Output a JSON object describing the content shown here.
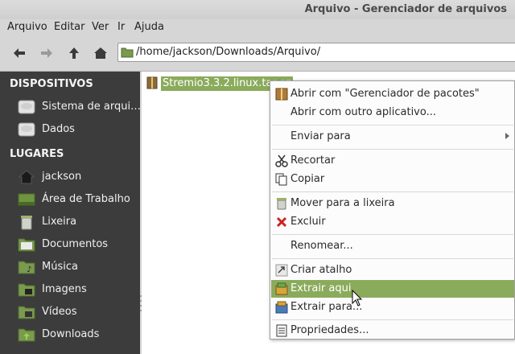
{
  "window": {
    "title": "Arquivo - Gerenciador de arquivos"
  },
  "menubar": [
    "Arquivo",
    "Editar",
    "Ver",
    "Ir",
    "Ajuda"
  ],
  "toolbar": {
    "back_icon": "back-arrow-icon",
    "forward_icon": "forward-arrow-icon",
    "up_icon": "up-arrow-icon",
    "home_icon": "home-icon",
    "path": "/home/jackson/Downloads/Arquivo/"
  },
  "sidebar": {
    "devices_header": "DISPOSITIVOS",
    "devices": [
      {
        "label": "Sistema de arqui…",
        "icon": "drive-icon"
      },
      {
        "label": "Dados",
        "icon": "drive-icon"
      }
    ],
    "places_header": "LUGARES",
    "places": [
      {
        "label": "jackson",
        "icon": "home-icon"
      },
      {
        "label": "Área de Trabalho",
        "icon": "desktop-icon"
      },
      {
        "label": "Lixeira",
        "icon": "trash-icon"
      },
      {
        "label": "Documentos",
        "icon": "folder-icon"
      },
      {
        "label": "Música",
        "icon": "music-folder-icon"
      },
      {
        "label": "Imagens",
        "icon": "pictures-folder-icon"
      },
      {
        "label": "Vídeos",
        "icon": "videos-folder-icon"
      },
      {
        "label": "Downloads",
        "icon": "downloads-folder-icon"
      }
    ]
  },
  "content": {
    "file": {
      "name": "Stremio3.3.2.linux.tar.gz",
      "icon": "archive-icon"
    }
  },
  "context_menu": {
    "items": [
      {
        "label": "Abrir com \"Gerenciador de pacotes\"",
        "icon": "package-icon"
      },
      {
        "label": "Abrir com outro aplicativo...",
        "icon": ""
      },
      {
        "label": "Enviar para",
        "icon": ""
      },
      {
        "label": "Recortar",
        "icon": "scissors-icon"
      },
      {
        "label": "Copiar",
        "icon": "copy-icon"
      },
      {
        "label": "Mover para a lixeira",
        "icon": "trash-icon"
      },
      {
        "label": "Excluir",
        "icon": "delete-icon"
      },
      {
        "label": "Renomear...",
        "icon": ""
      },
      {
        "label": "Criar atalho",
        "icon": "link-icon"
      },
      {
        "label": "Extrair aqui",
        "icon": "extract-icon"
      },
      {
        "label": "Extrair para...",
        "icon": "extract-to-icon"
      },
      {
        "label": "Propriedades...",
        "icon": "properties-icon"
      }
    ],
    "highlighted": "Extrair aqui"
  },
  "colors": {
    "accent": "#8bab5c",
    "sidebar_bg": "#3c3c3c",
    "window_bg": "#d6d6d6"
  }
}
